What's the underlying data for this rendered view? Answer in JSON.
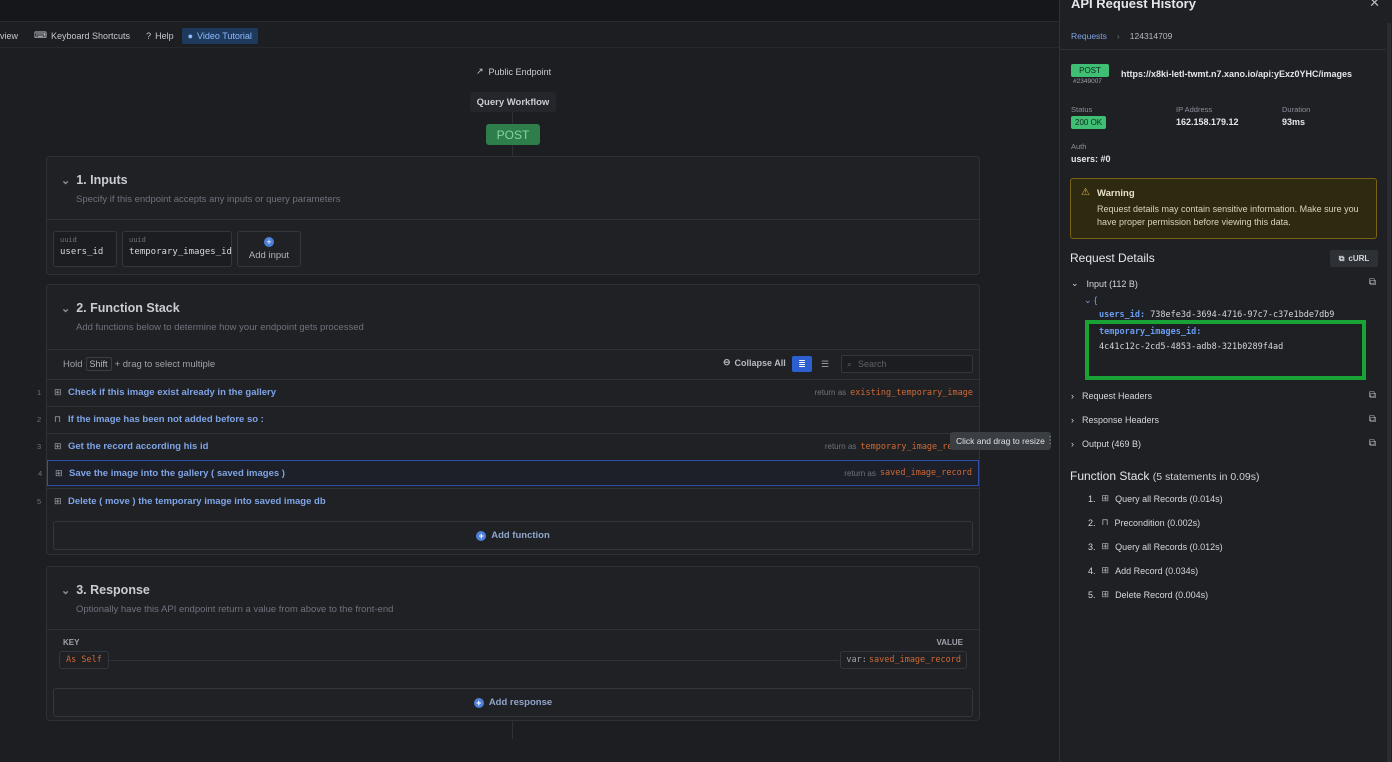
{
  "toolbar": {
    "items": [
      {
        "label": "view",
        "icon": "preview-icon"
      },
      {
        "label": "Keyboard Shortcuts",
        "icon": "keyboard-icon"
      },
      {
        "label": "Help",
        "icon": "help-circle-icon"
      },
      {
        "label": "Video Tutorial",
        "icon": "play-circle-icon"
      }
    ]
  },
  "endpoint": {
    "public_label": "Public Endpoint",
    "workflow_label": "Query Workflow",
    "method": "POST"
  },
  "inputs": {
    "title": "1. Inputs",
    "subtitle": "Specify if this endpoint accepts any inputs or query parameters",
    "items": [
      {
        "type": "uuid",
        "name": "users_id"
      },
      {
        "type": "uuid",
        "name": "temporary_images_id"
      }
    ],
    "add_label": "Add input"
  },
  "function_stack": {
    "title": "2. Function Stack",
    "subtitle": "Add functions below to determine how your endpoint gets processed",
    "hold_label": "Hold",
    "shift_key": "Shift",
    "drag_hint": "+ drag to select multiple",
    "collapse_label": "Collapse All",
    "search_placeholder": "Search",
    "rows": [
      {
        "num": "1",
        "label": "Check if this image exist already in the gallery",
        "return_as": "return as",
        "var": "existing_temporary_image"
      },
      {
        "num": "2",
        "label": "If the image has been not added before so :",
        "return_as": "",
        "var": ""
      },
      {
        "num": "3",
        "label": "Get the record according his id",
        "return_as": "return as",
        "var": "temporary_image_record"
      },
      {
        "num": "4",
        "label": "Save the image into the gallery ( saved images )",
        "return_as": "return as",
        "var": "saved_image_record"
      },
      {
        "num": "5",
        "label": "Delete ( move ) the temporary image into saved image db",
        "return_as": "",
        "var": ""
      }
    ],
    "add_label": "Add function"
  },
  "response": {
    "title": "3. Response",
    "subtitle": "Optionally have this API endpoint return a value from above to the front-end",
    "key_header": "KEY",
    "value_header": "VALUE",
    "key": "As Self",
    "value_prefix": "var:",
    "value": "saved_image_record",
    "add_label": "Add response"
  },
  "resize_tooltip": "Click and drag to resize",
  "panel": {
    "title": "API Request History",
    "breadcrumb": {
      "link": "Requests",
      "current": "124314709"
    },
    "method": "POST",
    "request_id": "#2349007",
    "url": "https://x8ki-letl-twmt.n7.xano.io/api:yExz0YHC/images",
    "status_label": "Status",
    "status_value": "200 OK",
    "ip_label": "IP Address",
    "ip_value": "162.158.179.12",
    "duration_label": "Duration",
    "duration_value": "93ms",
    "auth_label": "Auth",
    "auth_value": "users: #0",
    "warning_title": "Warning",
    "warning_body": "Request details may contain sensitive information. Make sure you have proper permission before viewing this data.",
    "details_title": "Request Details",
    "curl_label": "cURL",
    "input_label": "Input (112 B)",
    "json_open": "{",
    "json": [
      {
        "key": "users_id:",
        "value": "738efe3d-3694-4716-97c7-c37e1bde7db9"
      },
      {
        "key": "temporary_images_id:",
        "value": "4c41c12c-2cd5-4853-adb8-321b0289f4ad"
      }
    ],
    "request_headers": "Request Headers",
    "response_headers": "Response Headers",
    "output_label": "Output (469 B)",
    "fs_title": "Function Stack",
    "fs_summary": "(5 statements in 0.09s)",
    "fs_items": [
      {
        "num": "1.",
        "label": "Query all Records (0.014s)",
        "icon": "table-icon"
      },
      {
        "num": "2.",
        "label": "Precondition (0.002s)",
        "icon": "lock-icon"
      },
      {
        "num": "3.",
        "label": "Query all Records (0.012s)",
        "icon": "table-icon"
      },
      {
        "num": "4.",
        "label": "Add Record (0.034s)",
        "icon": "table-icon"
      },
      {
        "num": "5.",
        "label": "Delete Record (0.004s)",
        "icon": "table-icon"
      }
    ]
  },
  "colors": {
    "accent": "#2d5fd0",
    "success": "#3fbf74",
    "variable": "#d06a35",
    "highlight_box": "#19a337",
    "warning_border": "#7a6414"
  }
}
